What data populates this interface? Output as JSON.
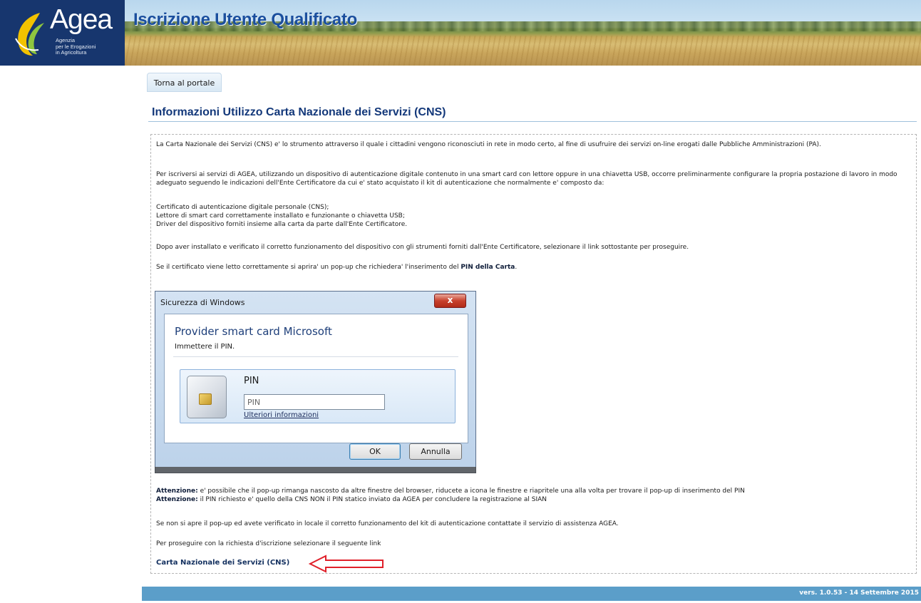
{
  "header": {
    "logo_word": "Agea",
    "logo_sub_1": "Agenzia",
    "logo_sub_2": "per le Erogazioni",
    "logo_sub_3": "in Agricoltura",
    "title": "Iscrizione Utente Qualificato"
  },
  "nav": {
    "back_label": "Torna al portale"
  },
  "section": {
    "title": "Informazioni Utilizzo Carta Nazionale dei Servizi (CNS)"
  },
  "content": {
    "p1": "La Carta Nazionale dei Servizi (CNS) e' lo strumento attraverso il quale i cittadini vengono riconosciuti in rete in modo certo, al fine di usufruire dei servizi on-line erogati dalle Pubbliche Amministrazioni (PA).",
    "p2": "Per iscriversi ai servizi di AGEA, utilizzando un dispositivo di autenticazione digitale contenuto in una smart card con lettore oppure in una chiavetta USB, occorre preliminarmente configurare la propria postazione di lavoro in modo adeguato seguendo le indicazioni dell'Ente Certificatore da cui e' stato acquistato il kit di autenticazione che normalmente e' composto da:",
    "list_1": "Certificato di autenticazione digitale personale (CNS);",
    "list_2": "Lettore di smart card correttamente installato e funzionante o chiavetta USB;",
    "list_3": "Driver del dispositivo forniti insieme alla carta da parte dall'Ente Certificatore.",
    "p3": "Dopo aver installato e verificato il corretto funzionamento del dispositivo con gli strumenti forniti dall'Ente Certificatore, selezionare il link sottostante per proseguire.",
    "p4_prefix": "Se il certificato viene letto correttamente si aprira' un pop-up che richiedera' l'inserimento del ",
    "p4_bold": "PIN della Carta",
    "p4_suffix": ".",
    "warn_label": "Attenzione:",
    "warn_1": " e' possibile che il pop-up rimanga nascosto da altre finestre del browser, riducete a icona le finestre e riapritele una alla volta per trovare il pop-up di inserimento del PIN",
    "warn_2": " il PIN richiesto e' quello della CNS NON il PIN statico inviato da AGEA per concludere la registrazione al SIAN",
    "p5": "Se non si apre il pop-up ed avete verificato in locale il corretto funzionamento del kit di autenticazione contattate il servizio di assistenza AGEA.",
    "p6": "Per proseguire con la richiesta d'iscrizione selezionare il seguente link",
    "cns_link": "Carta Nazionale dei Servizi (CNS)"
  },
  "dialog": {
    "window_title": "Sicurezza di Windows",
    "close_glyph": "x",
    "heading": "Provider smart card Microsoft",
    "subheading": "Immettere il PIN.",
    "pin_label": "PIN",
    "pin_placeholder": "PIN",
    "more_info": "Ulteriori informazioni",
    "ok_label": "OK",
    "cancel_label": "Annulla"
  },
  "footer": {
    "version": "vers. 1.0.53 - 14 Settembre 2015"
  },
  "colors": {
    "brand_navy": "#17366e",
    "title_blue": "#1b4f9e",
    "footer_blue": "#5b9ec9",
    "arrow_red": "#e0202a"
  },
  "icons": [
    "agea-logo-icon",
    "smart-card-icon",
    "close-icon",
    "red-arrow-icon"
  ]
}
